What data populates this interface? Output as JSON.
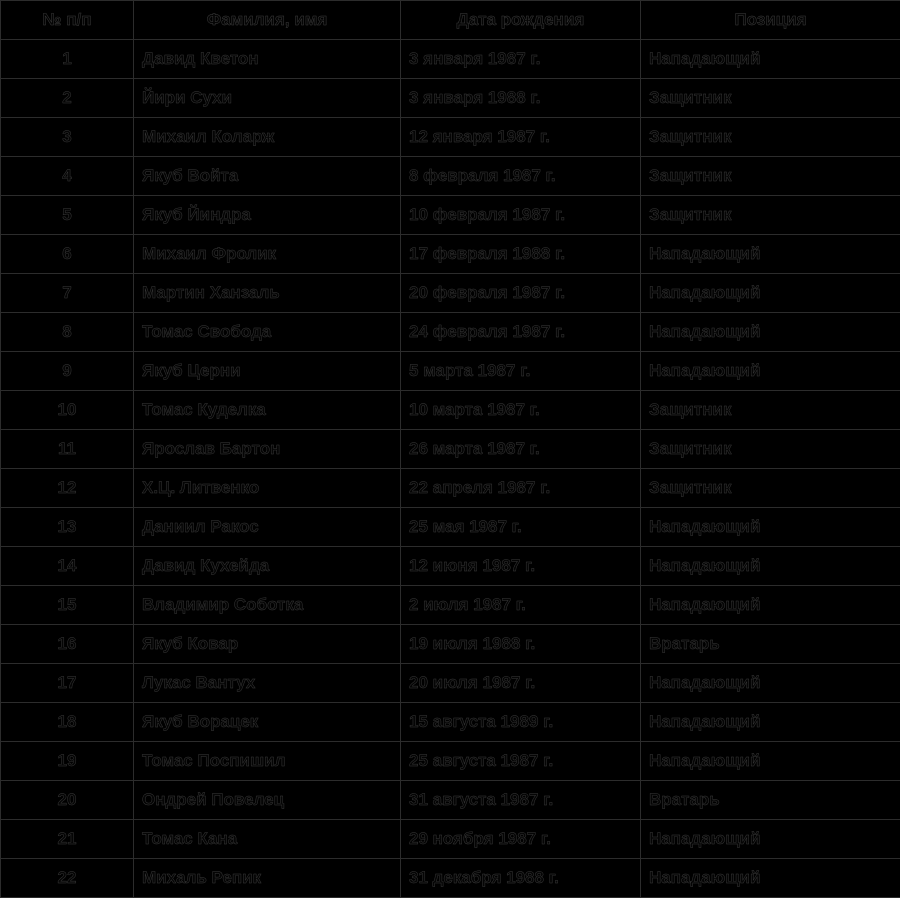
{
  "table": {
    "columns": [
      {
        "key": "num",
        "label": "№ п/п"
      },
      {
        "key": "name",
        "label": "Фамилия, имя"
      },
      {
        "key": "date",
        "label": "Дата рождения"
      },
      {
        "key": "pos",
        "label": "Позиция"
      }
    ],
    "rows": [
      {
        "num": "1",
        "name": "Давид Кветон",
        "date": "3 января 1987 г.",
        "pos": "Нападающий"
      },
      {
        "num": "2",
        "name": "Йири Сухи",
        "date": "3 января 1988 г.",
        "pos": "Защитник"
      },
      {
        "num": "3",
        "name": "Михаил Коларж",
        "date": "12 января 1987 г.",
        "pos": "Защитник"
      },
      {
        "num": "4",
        "name": "Якуб Войта",
        "date": "8 февраля 1987 г.",
        "pos": "Защитник"
      },
      {
        "num": "5",
        "name": "Якуб Йиндра",
        "date": "10 февраля 1987 г.",
        "pos": "Защитник"
      },
      {
        "num": "6",
        "name": "Михаил Фролик",
        "date": "17 февраля 1988 г.",
        "pos": "Нападающий"
      },
      {
        "num": "7",
        "name": "Мартин Ханзаль",
        "date": "20 февраля 1987 г.",
        "pos": "Нападающий"
      },
      {
        "num": "8",
        "name": "Томас Свобода",
        "date": "24 февраля 1987 г.",
        "pos": "Нападающий"
      },
      {
        "num": "9",
        "name": "Якуб Церни",
        "date": "5 марта 1987 г.",
        "pos": "Нападающий"
      },
      {
        "num": "10",
        "name": "Томас Куделка",
        "date": "10 марта 1987 г.",
        "pos": "Защитник"
      },
      {
        "num": "11",
        "name": "Ярослав Бартон",
        "date": "26 марта 1987 г.",
        "pos": "Защитник"
      },
      {
        "num": "12",
        "name": "Х.Ц. Литвенко",
        "date": "22 апреля 1987 г.",
        "pos": "Защитник"
      },
      {
        "num": "13",
        "name": "Даниил Ракос",
        "date": "25 мая 1987 г.",
        "pos": "Нападающий"
      },
      {
        "num": "14",
        "name": "Давид Кухейда",
        "date": "12 июня 1987 г.",
        "pos": "Нападающий"
      },
      {
        "num": "15",
        "name": "Владимир Соботка",
        "date": "2 июля 1987 г.",
        "pos": "Нападающий"
      },
      {
        "num": "16",
        "name": "Якуб Ковар",
        "date": "19 июля 1988 г.",
        "pos": "Вратарь"
      },
      {
        "num": "17",
        "name": "Лукас Вантух",
        "date": "20 июля 1987 г.",
        "pos": "Нападающий"
      },
      {
        "num": "18",
        "name": "Якуб Ворацек",
        "date": "15 августа 1989 г.",
        "pos": "Нападающий"
      },
      {
        "num": "19",
        "name": "Томас Поспишил",
        "date": "25 августа 1987 г.",
        "pos": "Нападающий"
      },
      {
        "num": "20",
        "name": "Ондрей Повелец",
        "date": "31 августа 1987 г.",
        "pos": "Вратарь"
      },
      {
        "num": "21",
        "name": "Томас Кана",
        "date": "29 ноября 1987 г.",
        "pos": "Нападающий"
      },
      {
        "num": "22",
        "name": "Михаль Репик",
        "date": "31 декабря 1988 г.",
        "pos": "Нападающий"
      }
    ]
  },
  "colors": {
    "background": "#000000",
    "text": "#050505",
    "border": "#2c2c2c",
    "border_bright": "#8a8a8a"
  }
}
